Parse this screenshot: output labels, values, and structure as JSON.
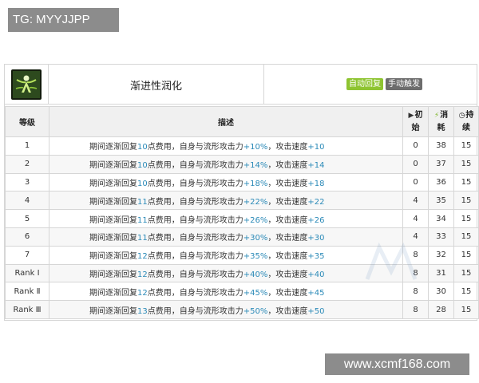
{
  "watermarks": {
    "top": "TG: MYYJJPP",
    "bottom": "www.xcmf168.com"
  },
  "skill": {
    "icon": "skill-icon",
    "name": "渐进性润化",
    "tags": [
      "自动回复",
      "手动触发"
    ],
    "colors": {
      "tag_auto": "#8ec431",
      "tag_manual": "#6d6d6d",
      "highlight": "#2b8ab8"
    }
  },
  "table": {
    "headers": {
      "level": "等级",
      "desc": "描述",
      "initial_top": "初",
      "initial_bottom": "始",
      "cost_top": "消",
      "cost_bottom": "耗",
      "duration_top": "持",
      "duration_bottom": "续"
    },
    "rows": [
      {
        "level": "1",
        "desc_a": "期间逐渐回复",
        "desc_b": "10",
        "desc_c": "点费用，自身与流形攻击力",
        "desc_d": "+10%",
        "desc_e": "，攻击速度",
        "desc_f": "+10",
        "initial": "0",
        "cost": "38",
        "duration": "15"
      },
      {
        "level": "2",
        "desc_a": "期间逐渐回复",
        "desc_b": "10",
        "desc_c": "点费用，自身与流形攻击力",
        "desc_d": "+14%",
        "desc_e": "，攻击速度",
        "desc_f": "+14",
        "initial": "0",
        "cost": "37",
        "duration": "15"
      },
      {
        "level": "3",
        "desc_a": "期间逐渐回复",
        "desc_b": "10",
        "desc_c": "点费用，自身与流形攻击力",
        "desc_d": "+18%",
        "desc_e": "，攻击速度",
        "desc_f": "+18",
        "initial": "0",
        "cost": "36",
        "duration": "15"
      },
      {
        "level": "4",
        "desc_a": "期间逐渐回复",
        "desc_b": "11",
        "desc_c": "点费用，自身与流形攻击力",
        "desc_d": "+22%",
        "desc_e": "，攻击速度",
        "desc_f": "+22",
        "initial": "4",
        "cost": "35",
        "duration": "15"
      },
      {
        "level": "5",
        "desc_a": "期间逐渐回复",
        "desc_b": "11",
        "desc_c": "点费用，自身与流形攻击力",
        "desc_d": "+26%",
        "desc_e": "，攻击速度",
        "desc_f": "+26",
        "initial": "4",
        "cost": "34",
        "duration": "15"
      },
      {
        "level": "6",
        "desc_a": "期间逐渐回复",
        "desc_b": "11",
        "desc_c": "点费用，自身与流形攻击力",
        "desc_d": "+30%",
        "desc_e": "，攻击速度",
        "desc_f": "+30",
        "initial": "4",
        "cost": "33",
        "duration": "15"
      },
      {
        "level": "7",
        "desc_a": "期间逐渐回复",
        "desc_b": "12",
        "desc_c": "点费用，自身与流形攻击力",
        "desc_d": "+35%",
        "desc_e": "，攻击速度",
        "desc_f": "+35",
        "initial": "8",
        "cost": "32",
        "duration": "15"
      },
      {
        "level": "Rank Ⅰ",
        "desc_a": "期间逐渐回复",
        "desc_b": "12",
        "desc_c": "点费用，自身与流形攻击力",
        "desc_d": "+40%",
        "desc_e": "，攻击速度",
        "desc_f": "+40",
        "initial": "8",
        "cost": "31",
        "duration": "15"
      },
      {
        "level": "Rank Ⅱ",
        "desc_a": "期间逐渐回复",
        "desc_b": "12",
        "desc_c": "点费用，自身与流形攻击力",
        "desc_d": "+45%",
        "desc_e": "，攻击速度",
        "desc_f": "+45",
        "initial": "8",
        "cost": "30",
        "duration": "15"
      },
      {
        "level": "Rank Ⅲ",
        "desc_a": "期间逐渐回复",
        "desc_b": "13",
        "desc_c": "点费用，自身与流形攻击力",
        "desc_d": "+50%",
        "desc_e": "，攻击速度",
        "desc_f": "+50",
        "initial": "8",
        "cost": "28",
        "duration": "15"
      }
    ]
  }
}
